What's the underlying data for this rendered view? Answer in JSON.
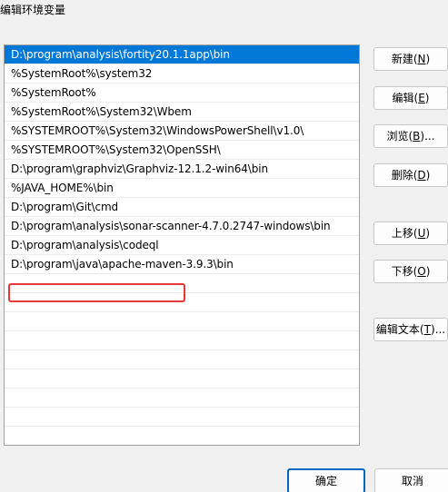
{
  "window": {
    "title": "编辑环境变量"
  },
  "path_list": {
    "items": [
      "D:\\program\\analysis\\fortity20.1.1app\\bin",
      "%SystemRoot%\\system32",
      "%SystemRoot%",
      "%SystemRoot%\\System32\\Wbem",
      "%SYSTEMROOT%\\System32\\WindowsPowerShell\\v1.0\\",
      "%SYSTEMROOT%\\System32\\OpenSSH\\",
      "D:\\program\\graphviz\\Graphviz-12.1.2-win64\\bin",
      "%JAVA_HOME%\\bin",
      "D:\\program\\Git\\cmd",
      "D:\\program\\analysis\\sonar-scanner-4.7.0.2747-windows\\bin",
      "D:\\program\\analysis\\codeql",
      "D:\\program\\java\\apache-maven-3.9.3\\bin"
    ],
    "selected_index": 0,
    "highlighted_index": 10
  },
  "buttons": {
    "new": {
      "label": "新建(",
      "key": "N",
      "suffix": ")"
    },
    "edit": {
      "label": "编辑(",
      "key": "E",
      "suffix": ")"
    },
    "browse": {
      "label": "浏览(",
      "key": "B",
      "suffix": ")..."
    },
    "delete": {
      "label": "删除(",
      "key": "D",
      "suffix": ")"
    },
    "move_up": {
      "label": "上移(",
      "key": "U",
      "suffix": ")"
    },
    "move_down": {
      "label": "下移(",
      "key": "O",
      "suffix": ")"
    },
    "edit_text": {
      "label": "编辑文本(",
      "key": "T",
      "suffix": ")..."
    }
  },
  "footer": {
    "ok": "确定",
    "cancel": "取消"
  },
  "colors": {
    "selection": "#0078d7",
    "highlight_border": "#e53935",
    "primary_border": "#0067c0"
  }
}
